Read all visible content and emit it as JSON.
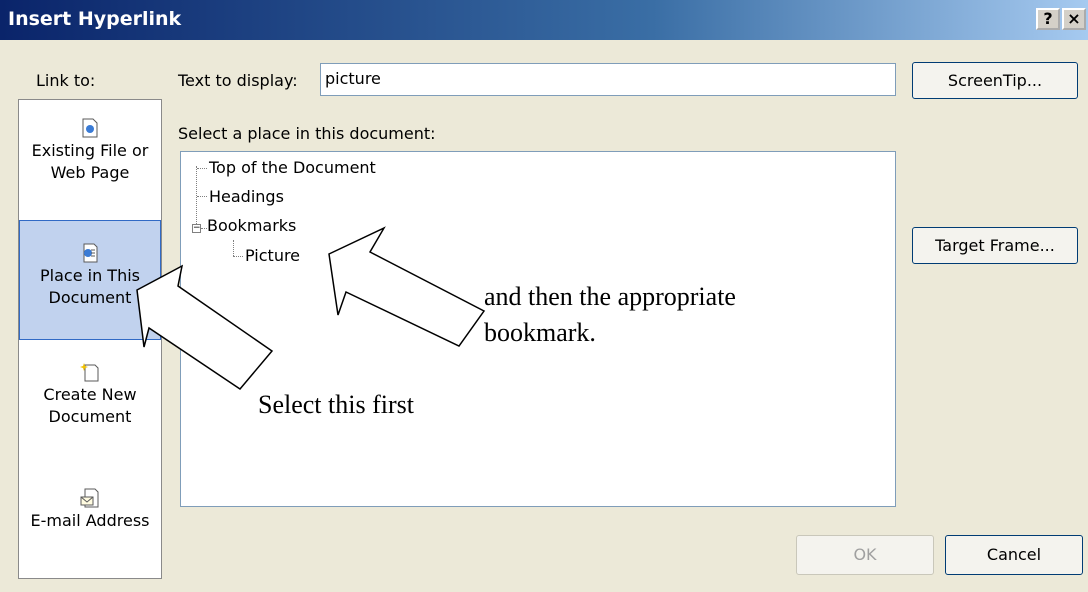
{
  "window": {
    "title": "Insert Hyperlink",
    "help_button": "?",
    "close_button": "×"
  },
  "sidebar": {
    "label": "Link to:",
    "items": [
      {
        "label": "Existing File or Web Page",
        "icon": "existing-file-icon"
      },
      {
        "label": "Place in This Document",
        "icon": "place-in-document-icon",
        "selected": true
      },
      {
        "label": "Create New Document",
        "icon": "create-new-document-icon"
      },
      {
        "label": "E-mail Address",
        "icon": "email-icon"
      }
    ]
  },
  "display": {
    "label": "Text to display:",
    "value": "picture"
  },
  "place": {
    "label": "Select a place in this document:",
    "tree": [
      "Top of the Document",
      "Headings",
      "Bookmarks",
      "Picture"
    ]
  },
  "buttons": {
    "screentip": "ScreenTip...",
    "target_frame": "Target Frame...",
    "ok": "OK",
    "cancel": "Cancel"
  },
  "annotations": {
    "select_first": "Select this first",
    "then_line1": "and then the appropriate",
    "then_line2": "bookmark."
  },
  "colors": {
    "title_bar": "#0a246a",
    "dialog_bg": "#ece9d8",
    "selection": "#c1d2ee"
  }
}
